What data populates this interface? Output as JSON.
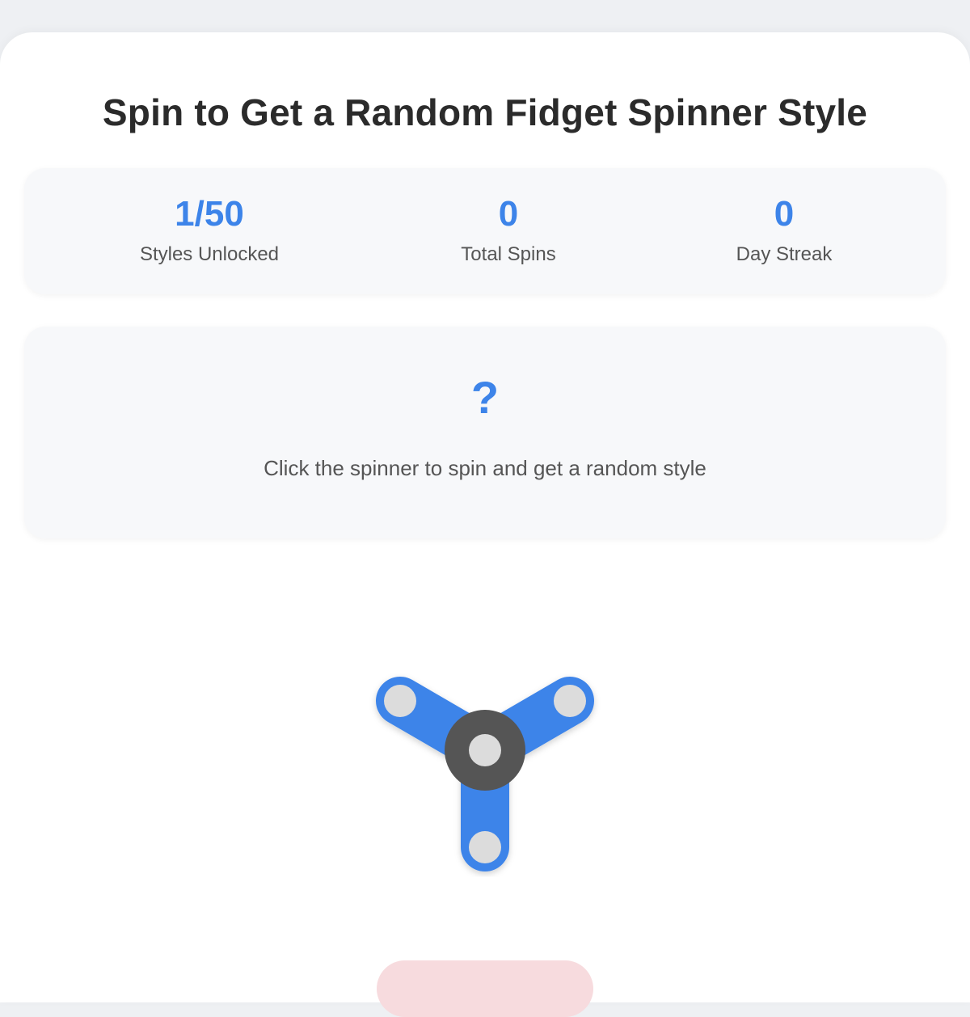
{
  "page": {
    "title": "Spin to Get a Random Fidget Spinner Style"
  },
  "stats": {
    "styles_unlocked": {
      "value": "1/50",
      "label": "Styles Unlocked"
    },
    "total_spins": {
      "value": "0",
      "label": "Total Spins"
    },
    "day_streak": {
      "value": "0",
      "label": "Day Streak"
    }
  },
  "result": {
    "mark": "?",
    "hint": "Click the spinner to spin and get a random style"
  },
  "spinner": {
    "arm_color": "#3d84e9",
    "hub_color": "#555555",
    "bearing_color": "#dcdcdc"
  },
  "spin_button": {
    "label": ""
  },
  "colors": {
    "accent": "#3d84e9",
    "background": "#eef0f3",
    "card": "#ffffff",
    "panel": "#f7f8fa",
    "button_bg": "#f7dbde"
  }
}
